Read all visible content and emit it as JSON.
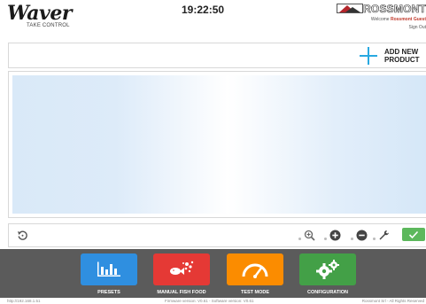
{
  "header": {
    "logo_word": "Waver",
    "logo_tagline": "TAKE CONTROL",
    "clock": "19:22:50",
    "brand_name": "ROSSMONT",
    "welcome_prefix": "Welcome",
    "welcome_user": "Rossmont Guest",
    "sign_out": "Sign Out"
  },
  "toolbar": {
    "add_new_line1": "ADD NEW",
    "add_new_line2": "PRODUCT"
  },
  "bottom_toolbar": {
    "icons": [
      "reset-icon",
      "zoom-in-icon",
      "plus-circle-icon",
      "minus-circle-icon",
      "wrench-icon",
      "check-icon"
    ],
    "check_color": "#5cb85c"
  },
  "nav": [
    {
      "label": "PRESETS",
      "color": "#2f8fe0",
      "icon": "bar-chart-icon"
    },
    {
      "label": "MANUAL FISH FOOD",
      "color": "#e53935",
      "icon": "fish-food-icon"
    },
    {
      "label": "TEST MODE",
      "color": "#fb8c00",
      "icon": "gauge-icon"
    },
    {
      "label": "CONFIGURATION",
      "color": "#43a047",
      "icon": "gears-icon"
    }
  ],
  "footer": {
    "ip": "http://192.168.1.51",
    "versions": "Firmware version: V0.61 - Software version: V0.61",
    "copyright": "Rossmont Srl - All Rights Reserved"
  },
  "colors": {
    "accent": "#29a9e1",
    "footer_bg": "#5b5b5b"
  }
}
